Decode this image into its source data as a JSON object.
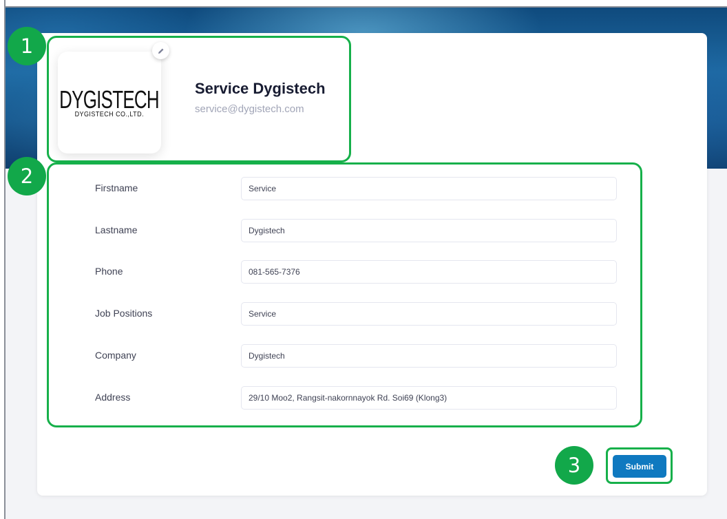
{
  "profile": {
    "logo_main": "DYGISTECH",
    "logo_sub": "DYGISTECH CO.,LTD.",
    "name": "Service Dygistech",
    "email": "service@dygistech.com",
    "edit_icon": "pencil-icon"
  },
  "form": {
    "fields": [
      {
        "label": "Firstname",
        "value": "Service"
      },
      {
        "label": "Lastname",
        "value": "Dygistech"
      },
      {
        "label": "Phone",
        "value": "081-565-7376"
      },
      {
        "label": "Job Positions",
        "value": "Service"
      },
      {
        "label": "Company",
        "value": "Dygistech"
      },
      {
        "label": "Address",
        "value": "29/10 Moo2, Rangsit-nakornnayok Rd. Soi69 (Klong3)"
      }
    ],
    "submit_label": "Submit"
  },
  "annotations": [
    "1",
    "2",
    "3"
  ],
  "colors": {
    "accent": "#0f79c0",
    "annotation": "#16b04a"
  }
}
